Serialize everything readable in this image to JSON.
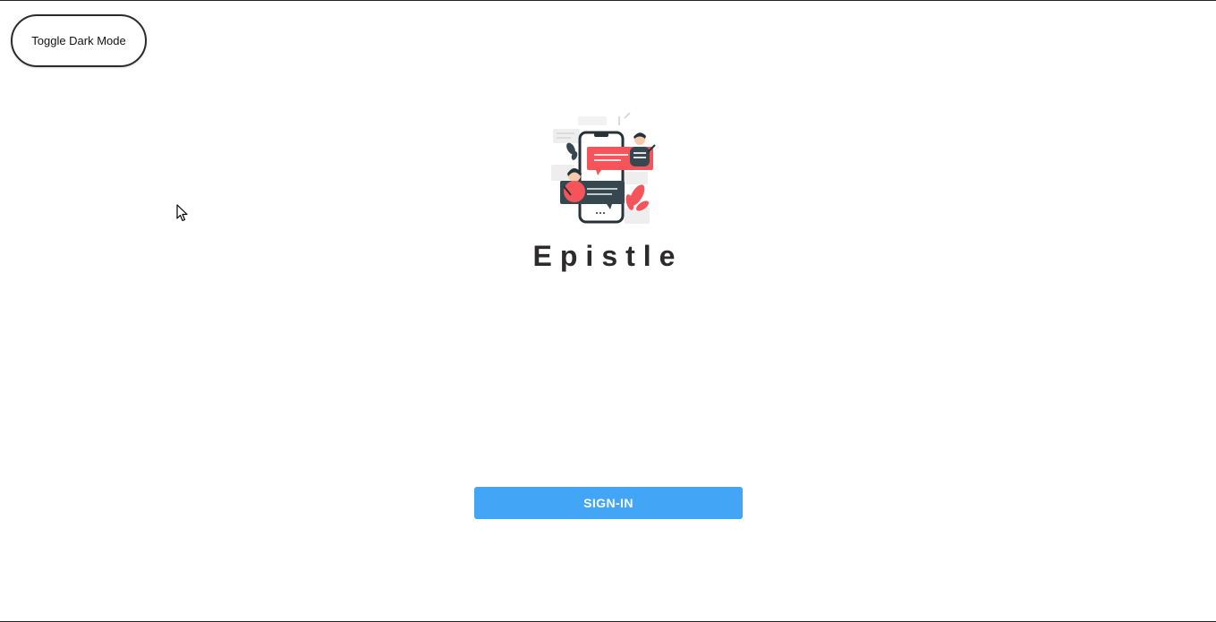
{
  "header": {
    "toggle_label": "Toggle Dark Mode"
  },
  "brand": {
    "title": "Epistle",
    "illustration_icon": "chat-illustration-icon"
  },
  "auth": {
    "signin_label": "SIGN-IN"
  },
  "colors": {
    "accent": "#42a5f5",
    "bubble_red": "#f4545a",
    "bubble_dark": "#37474f",
    "title_text": "#2e2a2c"
  }
}
